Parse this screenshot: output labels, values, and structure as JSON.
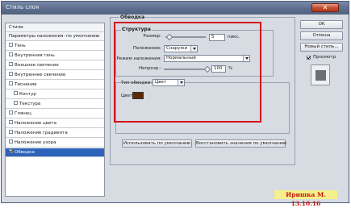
{
  "window": {
    "title": "Стиль слоя",
    "close_glyph": "✕"
  },
  "left_panel": {
    "header": "Стили",
    "subheader": "Параметры наложения: по умолчанию",
    "items": [
      {
        "label": "Тень",
        "checked": false
      },
      {
        "label": "Внутренняя тень",
        "checked": false
      },
      {
        "label": "Внешнее свечение",
        "checked": false
      },
      {
        "label": "Внутреннее свечение",
        "checked": false
      },
      {
        "label": "Тиснение",
        "checked": false
      },
      {
        "label": "Контур",
        "checked": false
      },
      {
        "label": "Текстура",
        "checked": false
      },
      {
        "label": "Глянец",
        "checked": false
      },
      {
        "label": "Наложение цвета",
        "checked": false
      },
      {
        "label": "Наложение градиента",
        "checked": false
      },
      {
        "label": "Наложение узора",
        "checked": false
      },
      {
        "label": "Обводка",
        "checked": true,
        "selected": true
      }
    ]
  },
  "main": {
    "group_title": "Обводка",
    "structure_title": "Структура",
    "size_label": "Размер:",
    "size_value": "5",
    "size_unit": "пикс.",
    "position_label": "Положение:",
    "position_value": "Снаружи",
    "blend_label": "Режим наложения:",
    "blend_value": "Нормальный",
    "opacity_label": "Непрозр.:",
    "opacity_value": "100",
    "opacity_unit": "%",
    "fill_type_label": "Тип обводки:",
    "fill_type_value": "Цвет",
    "color_label": "Цвет:",
    "color_value": "#5e2a06",
    "default_button": "Использовать по умолчанию",
    "reset_button": "Восстановить значения по умолчанию"
  },
  "right_panel": {
    "ok_button": "OK",
    "cancel_button": "Отмена",
    "new_style_button": "Новый стиль...",
    "preview_label": "Просмотр",
    "preview_checked": true
  },
  "watermark": "Иришка М. 13.10.16",
  "colors": {
    "selection": "#2d63b8",
    "highlight_frame": "#d3101c",
    "titlebar": "#5c6d8e"
  }
}
